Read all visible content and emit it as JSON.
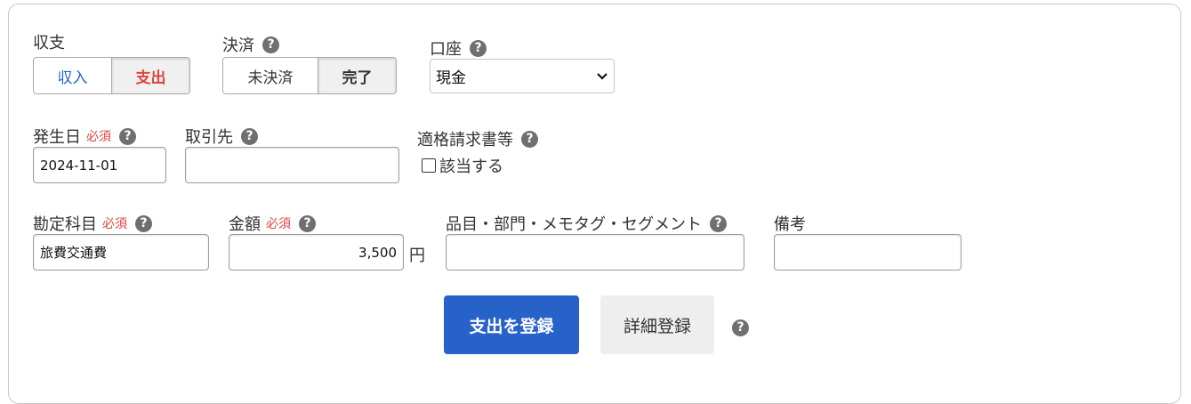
{
  "balance": {
    "label": "収支",
    "options": [
      "収入",
      "支出"
    ],
    "selected": "支出",
    "income_color": "#2762c9",
    "expense_color": "#e0443f"
  },
  "settlement": {
    "label": "決済",
    "options": [
      "未決済",
      "完了"
    ],
    "selected": "完了"
  },
  "account": {
    "label": "口座",
    "value": "現金"
  },
  "date": {
    "label": "発生日",
    "required": "必須",
    "value": "2024-11-01"
  },
  "partner": {
    "label": "取引先",
    "value": ""
  },
  "invoice": {
    "label": "適格請求書等",
    "checkbox_label": "該当する",
    "checked": false
  },
  "account_item": {
    "label": "勘定科目",
    "required": "必須",
    "value": "旅費交通費"
  },
  "amount": {
    "label": "金額",
    "required": "必須",
    "value": "3,500",
    "unit": "円"
  },
  "tags": {
    "label": "品目・部門・メモタグ・セグメント",
    "value": ""
  },
  "note": {
    "label": "備考",
    "value": ""
  },
  "actions": {
    "submit_label": "支出を登録",
    "detail_label": "詳細登録"
  },
  "help_glyph": "?"
}
